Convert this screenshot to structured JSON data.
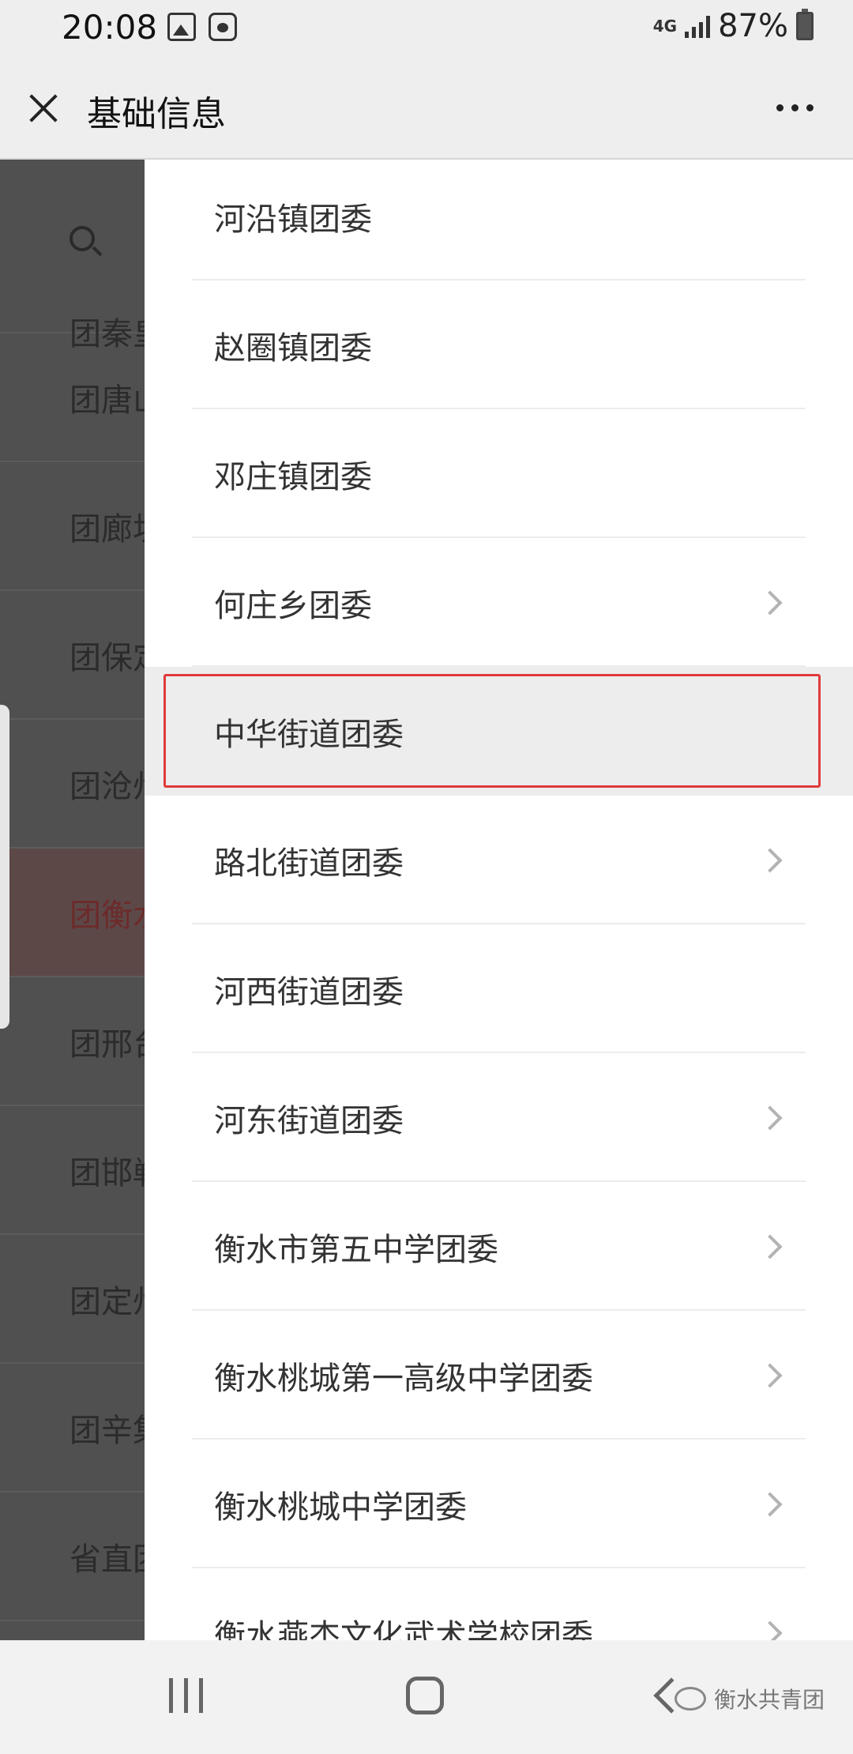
{
  "status_bar": {
    "time": "20:08",
    "network": "4G",
    "battery": "87%",
    "icons": [
      "gallery-icon",
      "baidu-paw-icon"
    ]
  },
  "title_bar": {
    "title": "基础信息",
    "close_icon": "close-icon",
    "more_icon": "more-icon"
  },
  "background_list": {
    "search_icon": "search-icon",
    "items": [
      {
        "label": "团秦皇"
      },
      {
        "label": "团唐山"
      },
      {
        "label": "团廊坊"
      },
      {
        "label": "团保定"
      },
      {
        "label": "团沧州"
      },
      {
        "label": "团衡水"
      },
      {
        "label": "团邢台"
      },
      {
        "label": "团邯郸"
      },
      {
        "label": "团定州"
      },
      {
        "label": "团辛集"
      },
      {
        "label": "省直团"
      }
    ]
  },
  "drawer": {
    "items": [
      {
        "label": "河沿镇团委",
        "has_children": false,
        "selected": false
      },
      {
        "label": "赵圈镇团委",
        "has_children": false,
        "selected": false
      },
      {
        "label": "邓庄镇团委",
        "has_children": false,
        "selected": false
      },
      {
        "label": "何庄乡团委",
        "has_children": true,
        "selected": false
      },
      {
        "label": "中华街道团委",
        "has_children": false,
        "selected": true
      },
      {
        "label": "路北街道团委",
        "has_children": true,
        "selected": false
      },
      {
        "label": "河西街道团委",
        "has_children": false,
        "selected": false
      },
      {
        "label": "河东街道团委",
        "has_children": true,
        "selected": false
      },
      {
        "label": "衡水市第五中学团委",
        "has_children": true,
        "selected": false
      },
      {
        "label": "衡水桃城第一高级中学团委",
        "has_children": true,
        "selected": false
      },
      {
        "label": "衡水桃城中学团委",
        "has_children": true,
        "selected": false
      },
      {
        "label": "衡水燕杰文化武术学校团委",
        "has_children": true,
        "selected": false
      }
    ],
    "highlight_color": "#e03a3a"
  },
  "nav_bar": {
    "icons": [
      "recents-icon",
      "home-icon",
      "back-icon"
    ],
    "watermark": "衡水共青团"
  }
}
